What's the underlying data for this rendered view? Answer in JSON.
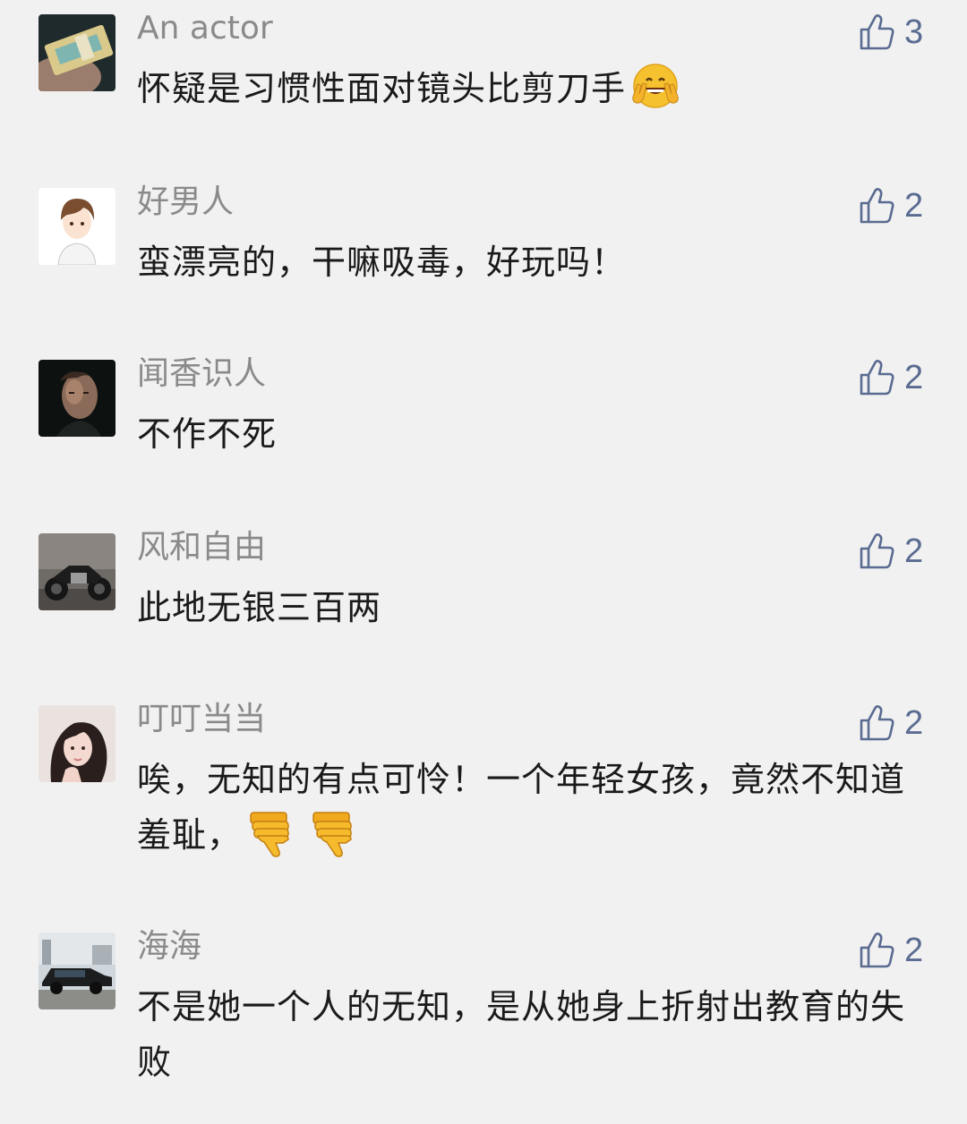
{
  "comments": [
    {
      "nickname": "An actor",
      "content": "怀疑是习惯性面对镜头比剪刀手",
      "emoji": "victory-hands-emoji",
      "likes": "3",
      "avatar": "ticket-in-hand-avatar"
    },
    {
      "nickname": "好男人",
      "content": "蛮漂亮的，干嘛吸毒，好玩吗！",
      "likes": "2",
      "avatar": "anime-boy-avatar"
    },
    {
      "nickname": "闻香识人",
      "content": "不作不死",
      "likes": "2",
      "avatar": "man-portrait-avatar"
    },
    {
      "nickname": "风和自由",
      "content": "此地无银三百两",
      "likes": "2",
      "avatar": "motorcycle-avatar"
    },
    {
      "nickname": "叮叮当当",
      "content": "唉，无知的有点可怜！一个年轻女孩，竟然不知道羞耻，",
      "emoji": "thumbs-down-emoji x2",
      "likes": "2",
      "avatar": "girl-portrait-avatar"
    },
    {
      "nickname": "海海",
      "content": "不是她一个人的无知，是从她身上折射出教育的失败",
      "likes": "2",
      "avatar": "car-avatar"
    }
  ],
  "colors": {
    "background": "#f1f1f1",
    "nickname": "#8a8a8a",
    "content": "#1a1a1a",
    "like_accent": "#5a6b91"
  }
}
